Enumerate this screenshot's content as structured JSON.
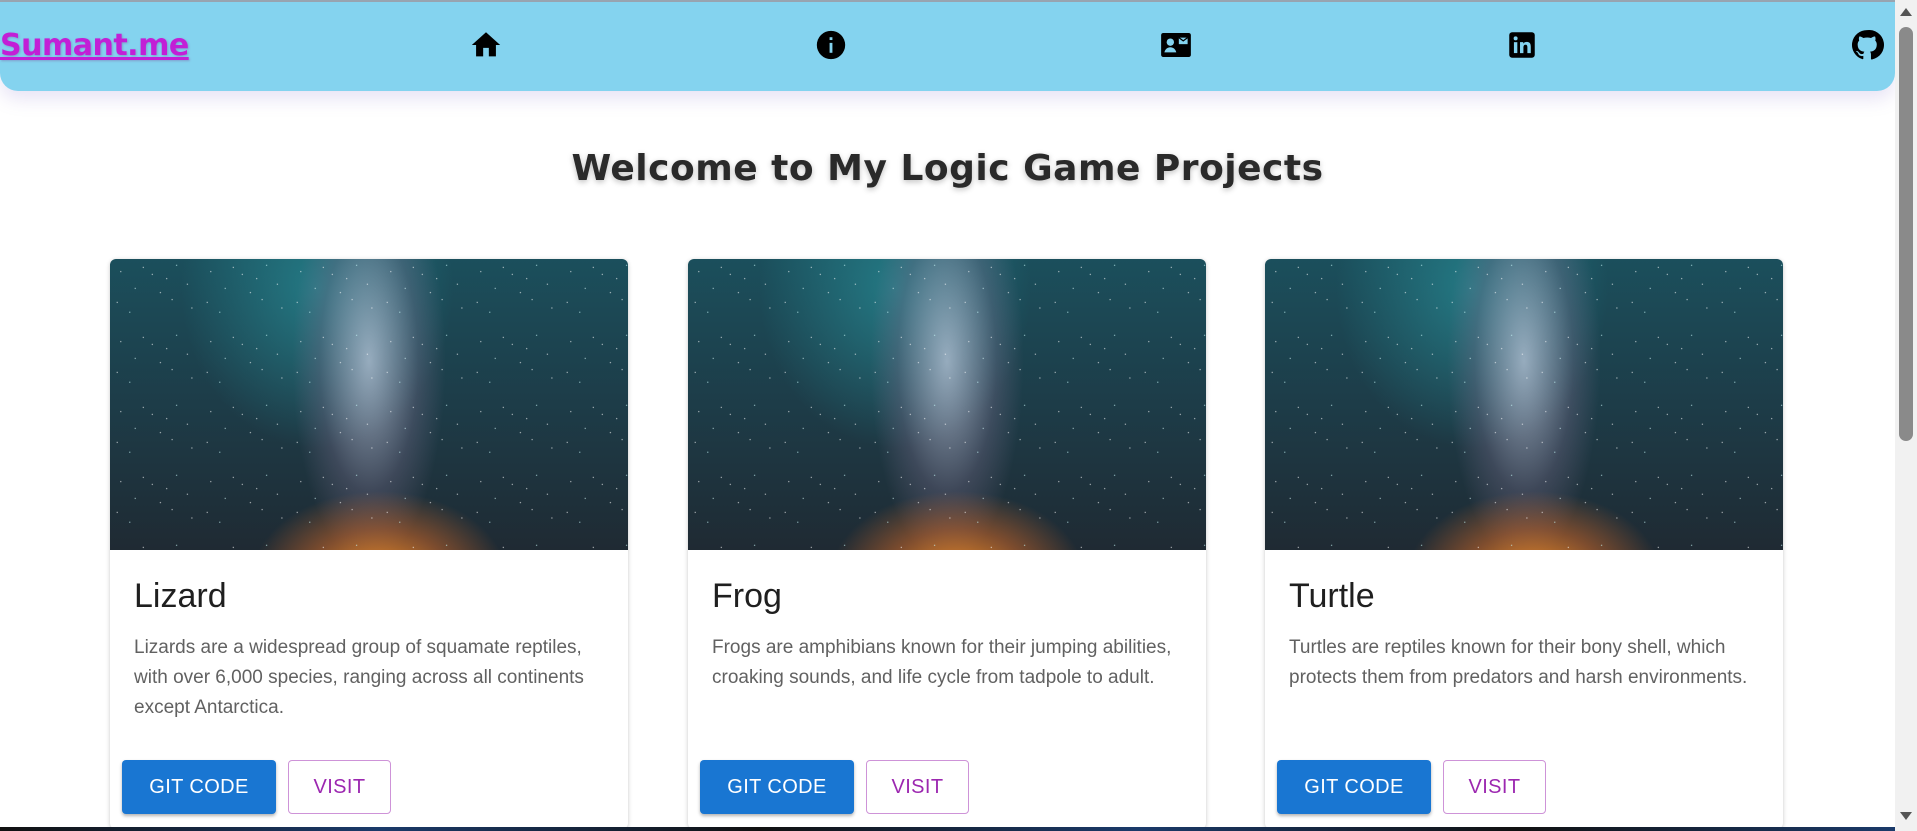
{
  "navbar": {
    "brand": "Sumant.me",
    "bg_color": "#84d3ef",
    "brand_color": "#c21fd6",
    "icons": [
      "home-icon",
      "info-icon",
      "contact-card-icon",
      "linkedin-icon",
      "github-icon"
    ]
  },
  "main": {
    "heading": "Welcome to My Logic Game Projects"
  },
  "cards": [
    {
      "title": "Lizard",
      "description": "Lizards are a widespread group of squamate reptiles, with over 6,000 species, ranging across all continents except Antarctica.",
      "git_label": "GIT CODE",
      "visit_label": "VISIT"
    },
    {
      "title": "Frog",
      "description": "Frogs are amphibians known for their jumping abilities, croaking sounds, and life cycle from tadpole to adult.",
      "git_label": "GIT CODE",
      "visit_label": "VISIT"
    },
    {
      "title": "Turtle",
      "description": "Turtles are reptiles known for their bony shell, which protects them from predators and harsh environments.",
      "git_label": "GIT CODE",
      "visit_label": "VISIT"
    }
  ],
  "colors": {
    "primary_button": "#1976d2",
    "visit_text": "#9c27b0"
  }
}
